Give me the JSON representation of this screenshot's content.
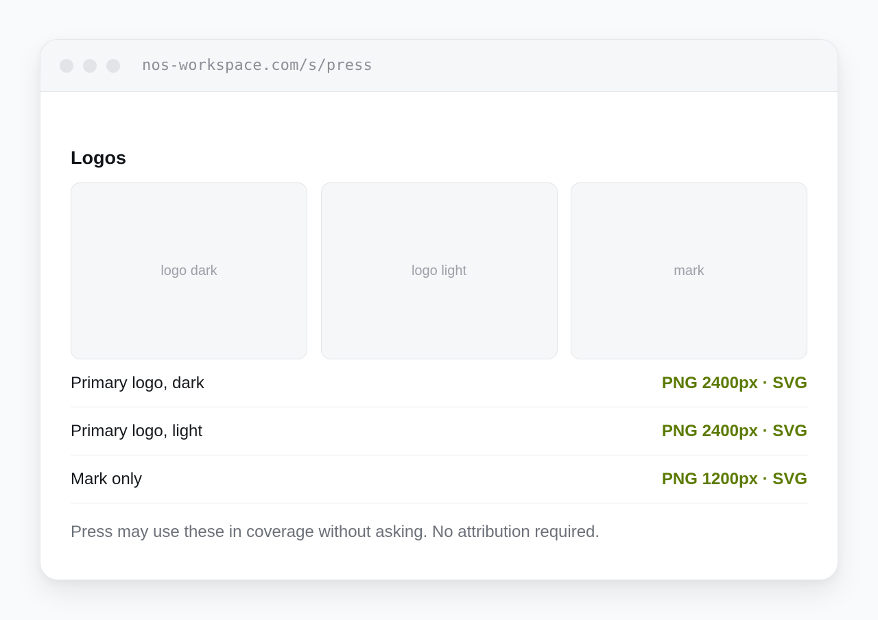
{
  "browser": {
    "url": "nos-workspace.com/s/press"
  },
  "section": {
    "title": "Logos"
  },
  "tiles": [
    {
      "label": "logo dark"
    },
    {
      "label": "logo light"
    },
    {
      "label": "mark"
    }
  ],
  "assets": [
    {
      "name": "Primary logo, dark",
      "download": "PNG 2400px · SVG"
    },
    {
      "name": "Primary logo, light",
      "download": "PNG 2400px · SVG"
    },
    {
      "name": "Mark only",
      "download": "PNG 1200px · SVG"
    }
  ],
  "note": "Press may use these in coverage without asking. No attribution required.",
  "colors": {
    "link": "#5b7a00",
    "text": "#16191d",
    "muted": "#6b7078"
  }
}
